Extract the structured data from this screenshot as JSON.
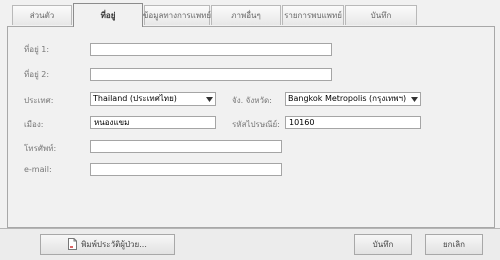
{
  "tabs": [
    {
      "label": "ส่วนตัว"
    },
    {
      "label": "ที่อยู่"
    },
    {
      "label": "ข้อมูลทางการแพทย์"
    },
    {
      "label": "ภาพอื่นๆ"
    },
    {
      "label": "รายการพบแพทย์"
    },
    {
      "label": "บันทึก"
    }
  ],
  "form": {
    "address1": {
      "label": "ที่อยู่ 1:",
      "value": ""
    },
    "address2": {
      "label": "ที่อยู่ 2:",
      "value": ""
    },
    "country": {
      "label": "ประเทศ:",
      "value": "Thailand (ประเทศไทย)"
    },
    "province": {
      "label": "จัง. จังหวัด:",
      "value": "Bangkok Metropolis (กรุงเทพฯ)"
    },
    "city": {
      "label": "เมือง:",
      "value": "หนองแขม"
    },
    "postal_code": {
      "label": "รหัสไปรษณีย์:",
      "value": "10160"
    },
    "phone": {
      "label": "โทรศัพท์:",
      "value": ""
    },
    "email": {
      "label": "e-mail:",
      "value": ""
    }
  },
  "buttons": {
    "print": "พิมพ์ประวัติผู้ป่วย...",
    "save": "บันทึก",
    "cancel": "ยกเลิก"
  },
  "icons": {
    "dropdown": "chevron-down-icon",
    "print": "document-icon"
  }
}
